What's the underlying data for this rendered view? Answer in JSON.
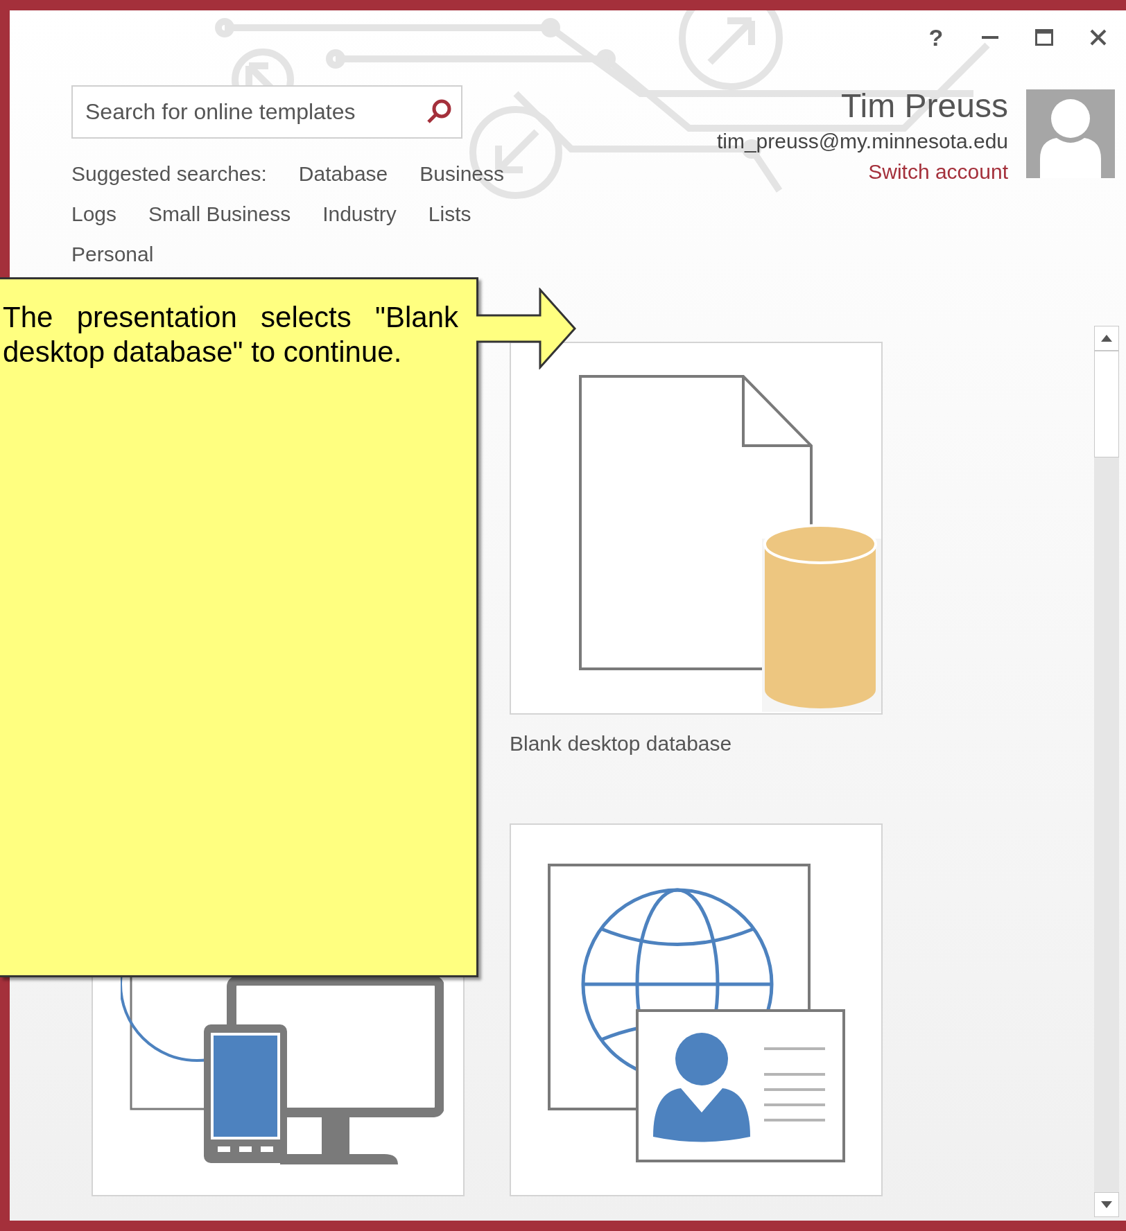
{
  "window_controls": [
    {
      "kind": "help",
      "label": "?"
    },
    {
      "kind": "minimize"
    },
    {
      "kind": "maximize"
    },
    {
      "kind": "close"
    }
  ],
  "search": {
    "placeholder": "Search for online templates"
  },
  "suggested_searches": {
    "label": "Suggested searches:",
    "items": [
      "Database",
      "Business",
      "Logs",
      "Small Business",
      "Industry",
      "Lists",
      "Personal"
    ]
  },
  "account": {
    "name": "Tim Preuss",
    "email": "tim_preuss@my.minnesota.edu",
    "switch_label": "Switch account"
  },
  "callout": {
    "text": "The presentation selects \"Blank desktop database\" to continue."
  },
  "templates": [
    {
      "kind": "hidden"
    },
    {
      "kind": "blank_desktop",
      "label": "Blank desktop database"
    },
    {
      "kind": "devices"
    },
    {
      "kind": "web_contacts"
    }
  ]
}
